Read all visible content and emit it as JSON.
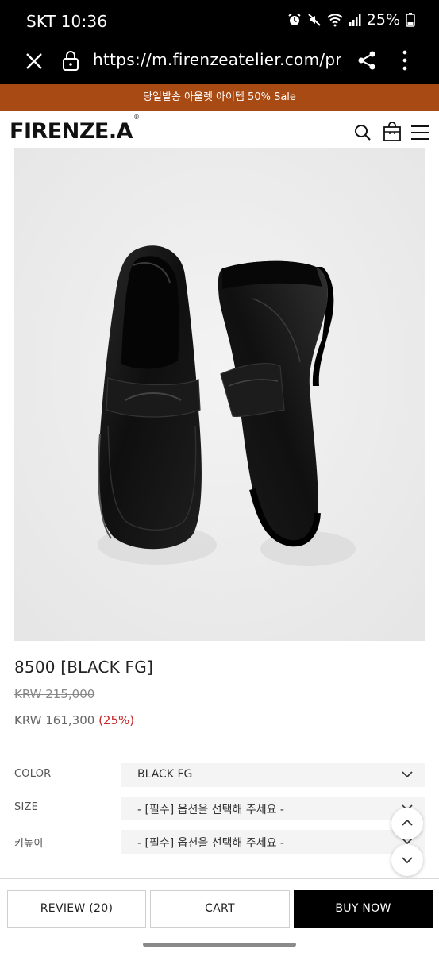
{
  "status_bar": {
    "carrier_time": "SKT 10:36",
    "battery": "25%",
    "icons": [
      "alarm-icon",
      "mute-icon",
      "wifi-icon",
      "signal-icon",
      "battery-icon"
    ]
  },
  "browser": {
    "url": "https://m.firenzeatelier.com/product",
    "icons": [
      "close-icon",
      "lock-icon",
      "share-icon",
      "more-vert-icon"
    ]
  },
  "promo_banner": {
    "text": "당일발송 아울렛 아이템 50% Sale",
    "color": "#a84a13"
  },
  "header": {
    "logo_text": "FIRENZE.A",
    "logo_mark": "®",
    "icons": [
      "search-icon",
      "shopping-bag-icon",
      "hamburger-menu-icon"
    ]
  },
  "product": {
    "name": "8500 [BLACK FG]",
    "original_price": "KRW 215,000",
    "sale_price": "KRW 161,300",
    "discount": "(25%)",
    "discount_color": "#c0282a",
    "image_subject": "black-penny-loafers"
  },
  "options": [
    {
      "label": "COLOR",
      "value": "BLACK FG"
    },
    {
      "label": "SIZE",
      "value": "- [필수] 옵션을 선택해 주세요 -"
    },
    {
      "label": "키높이",
      "value": "- [필수] 옵션을 선택해 주세요 -"
    }
  ],
  "floating": {
    "icons": [
      "chevron-up-icon",
      "chevron-down-icon"
    ]
  },
  "bottom_bar": {
    "review_label": "REVIEW (20)",
    "cart_label": "CART",
    "buy_label": "BUY NOW"
  }
}
